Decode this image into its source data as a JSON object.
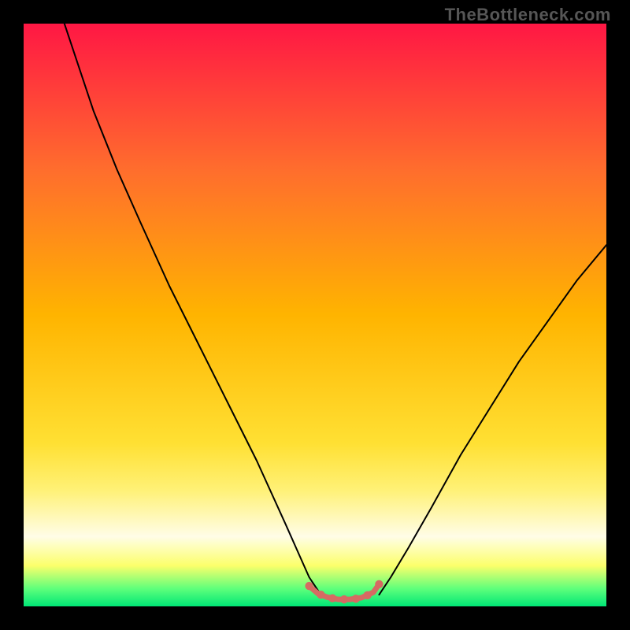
{
  "watermark": "TheBottleneck.com",
  "chart_data": {
    "type": "line",
    "title": "",
    "xlabel": "",
    "ylabel": "",
    "xlim": [
      0,
      100
    ],
    "ylim": [
      0,
      100
    ],
    "grid": false,
    "legend": false,
    "gradient_stops": [
      {
        "offset": 0,
        "color": "#ff1744"
      },
      {
        "offset": 25,
        "color": "#ff6d2d"
      },
      {
        "offset": 50,
        "color": "#ffb400"
      },
      {
        "offset": 72,
        "color": "#ffe033"
      },
      {
        "offset": 80,
        "color": "#fff176"
      },
      {
        "offset": 88,
        "color": "#fffde7"
      },
      {
        "offset": 93,
        "color": "#fcff6b"
      },
      {
        "offset": 97,
        "color": "#5dff7b"
      },
      {
        "offset": 100,
        "color": "#00e676"
      }
    ],
    "series": [
      {
        "name": "curve-left",
        "type": "line",
        "stroke": "#000000",
        "stroke_width": 2,
        "x": [
          7,
          9,
          12,
          16,
          20,
          25,
          30,
          35,
          40,
          45,
          49,
          51
        ],
        "values": [
          100,
          94,
          85,
          75,
          66,
          55,
          45,
          35,
          25,
          14,
          5,
          2
        ]
      },
      {
        "name": "curve-right",
        "type": "line",
        "stroke": "#000000",
        "stroke_width": 2,
        "x": [
          61,
          63,
          66,
          70,
          75,
          80,
          85,
          90,
          95,
          100
        ],
        "values": [
          2,
          5,
          10,
          17,
          26,
          34,
          42,
          49,
          56,
          62
        ]
      },
      {
        "name": "trough-segment",
        "type": "line",
        "stroke": "#d66a63",
        "stroke_width": 7,
        "x": [
          49,
          50.5,
          52,
          54,
          56,
          58,
          60,
          61
        ],
        "values": [
          3.5,
          2.2,
          1.6,
          1.2,
          1.2,
          1.5,
          2.4,
          3.8
        ]
      },
      {
        "name": "trough-points",
        "type": "scatter",
        "fill": "#d66a63",
        "radius": 5.2,
        "x": [
          49,
          51,
          53,
          55,
          57,
          59,
          61
        ],
        "values": [
          3.5,
          2.0,
          1.4,
          1.2,
          1.3,
          1.9,
          3.8
        ]
      }
    ]
  }
}
